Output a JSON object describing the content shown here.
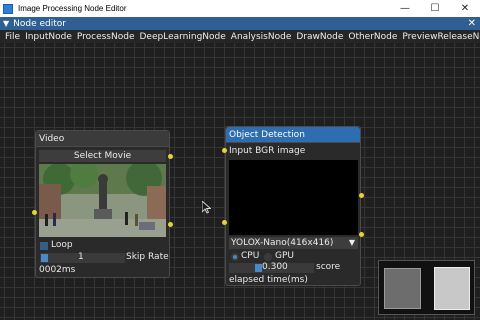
{
  "window": {
    "title": "Image Processing Node Editor",
    "minimize": "—",
    "maximize": "☐",
    "close": "✕"
  },
  "editor": {
    "collapse_glyph": "▼",
    "label": "Node editor",
    "close_glyph": "✕"
  },
  "menu": [
    "File",
    "InputNode",
    "ProcessNode",
    "DeepLearningNode",
    "AnalysisNode",
    "DrawNode",
    "OtherNode",
    "PreviewReleaseNode"
  ],
  "video_node": {
    "title": "Video",
    "select_button": "Select Movie",
    "loop_label": "Loop",
    "skip_value": "1",
    "skip_label": "Skip Rate",
    "elapsed": "0002ms"
  },
  "detection_node": {
    "title": "Object Detection",
    "input_label": "Input BGR image",
    "model": "YOLOX-Nano(416x416)",
    "combo_arrow": "▼",
    "cpu_label": "CPU",
    "gpu_label": "GPU",
    "score_value": "0.300",
    "score_label": "score",
    "elapsed_label": "elapsed time(ms)"
  },
  "colors": {
    "titlebar_accent": "#2f5f93",
    "selected_node": "#2d6db0",
    "pin": "#e6d23a",
    "grid": "#353535"
  },
  "icons": {
    "app": "app-icon",
    "cursor": "mouse-pointer-icon"
  }
}
